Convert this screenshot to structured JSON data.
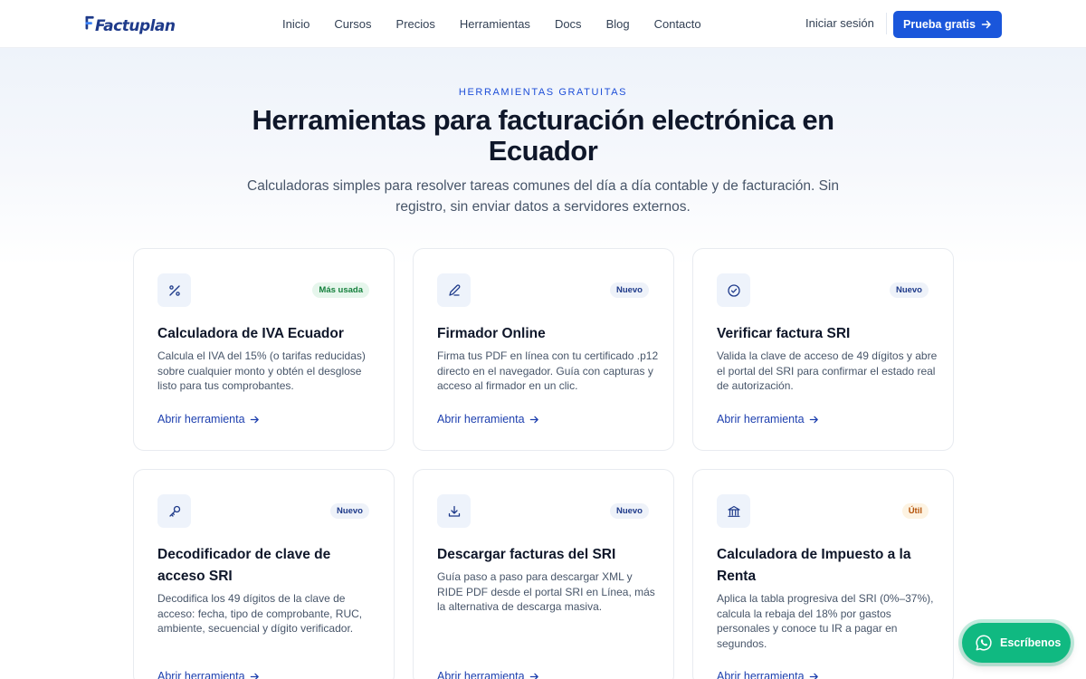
{
  "header": {
    "logo_text": "Factuplan",
    "nav": [
      "Inicio",
      "Cursos",
      "Precios",
      "Herramientas",
      "Docs",
      "Blog",
      "Contacto"
    ],
    "login_label": "Iniciar sesión",
    "cta_label": "Prueba gratis"
  },
  "hero": {
    "eyebrow": "HERRAMIENTAS GRATUITAS",
    "title": "Herramientas para facturación electrónica en Ecuador",
    "subtitle": "Calculadoras simples para resolver tareas comunes del día a día contable y de facturación. Sin registro, sin enviar datos a servidores externos."
  },
  "cards": [
    {
      "icon": "percent-icon",
      "badge": "Más usada",
      "badge_color": "#15803d",
      "title": "Calculadora de IVA Ecuador",
      "description": "Calcula el IVA del 15% (o tarifas reducidas) sobre cualquier monto y obtén el desglose listo para tus comprobantes.",
      "link": "Abrir herramienta"
    },
    {
      "icon": "pen-icon",
      "badge": "Nuevo",
      "badge_color": "#1e3a8a",
      "title": "Firmador Online",
      "description": "Firma tus PDF en línea con tu certificado .p12 directo en el navegador. Guía con capturas y acceso al firmador en un clic.",
      "link": "Abrir herramienta"
    },
    {
      "icon": "check-circle-icon",
      "badge": "Nuevo",
      "badge_color": "#1e3a8a",
      "title": "Verificar factura SRI",
      "description": "Valida la clave de acceso de 49 dígitos y abre el portal del SRI para confirmar el estado real de autorización.",
      "link": "Abrir herramienta"
    },
    {
      "icon": "key-icon",
      "badge": "Nuevo",
      "badge_color": "#1e3a8a",
      "title": "Decodificador de clave de acceso SRI",
      "description": "Decodifica los 49 dígitos de la clave de acceso: fecha, tipo de comprobante, RUC, ambiente, secuencial y dígito verificador.",
      "link": "Abrir herramienta"
    },
    {
      "icon": "download-icon",
      "badge": "Nuevo",
      "badge_color": "#1e3a8a",
      "title": "Descargar facturas del SRI",
      "description": "Guía paso a paso para descargar XML y RIDE PDF desde el portal SRI en Línea, más la alternativa de descarga masiva.",
      "link": "Abrir herramienta"
    },
    {
      "icon": "bank-icon",
      "badge": "Útil",
      "badge_color": "#b45309",
      "title": "Calculadora de Impuesto a la Renta",
      "description": "Aplica la tabla progresiva del SRI (0%–37%), calcula la rebaja del 18% por gastos personales y conoce tu IR a pagar en segundos.",
      "link": "Abrir herramienta"
    }
  ],
  "whatsapp": {
    "label": "Escríbenos"
  },
  "colors": {
    "accent": "#1a56db",
    "link": "#1e40af",
    "whatsapp": "#10b981"
  }
}
